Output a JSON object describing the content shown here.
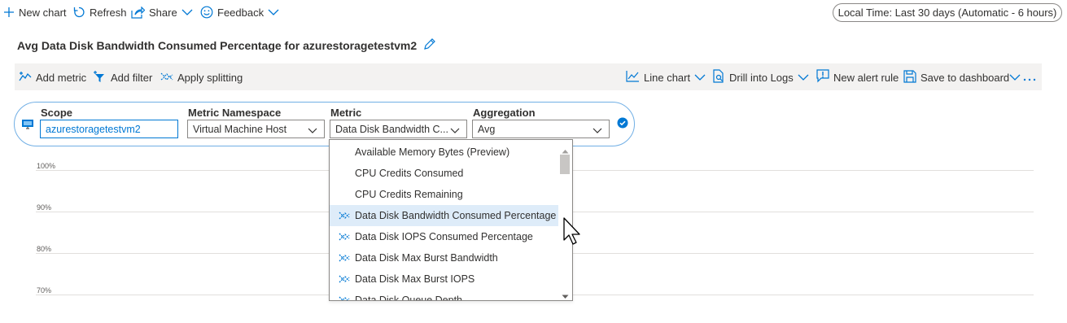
{
  "toolbar": {
    "new_chart": "New chart",
    "refresh": "Refresh",
    "share": "Share",
    "feedback": "Feedback",
    "time_range": "Local Time: Last 30 days (Automatic - 6 hours)"
  },
  "page": {
    "title": "Avg Data Disk Bandwidth Consumed Percentage for azurestoragetestvm2"
  },
  "commands": {
    "add_metric": "Add metric",
    "add_filter": "Add filter",
    "apply_splitting": "Apply splitting",
    "line_chart": "Line chart",
    "drill_into_logs": "Drill into Logs",
    "new_alert_rule": "New alert rule",
    "save_to_dashboard": "Save to dashboard"
  },
  "metric_selector": {
    "scope_label": "Scope",
    "scope_value": "azurestoragetestvm2",
    "namespace_label": "Metric Namespace",
    "namespace_value": "Virtual Machine Host",
    "metric_label": "Metric",
    "metric_value": "Data Disk Bandwidth C...",
    "aggregation_label": "Aggregation",
    "aggregation_value": "Avg"
  },
  "chart": {
    "y_ticks": [
      "100%",
      "90%",
      "80%",
      "70%"
    ]
  },
  "metric_dropdown": {
    "items": [
      {
        "label": "Available Memory Bytes (Preview)",
        "icon": "none"
      },
      {
        "label": "CPU Credits Consumed",
        "icon": "none"
      },
      {
        "label": "CPU Credits Remaining",
        "icon": "none"
      },
      {
        "label": "Data Disk Bandwidth Consumed Percentage",
        "icon": "metric-icon",
        "selected": true
      },
      {
        "label": "Data Disk IOPS Consumed Percentage",
        "icon": "metric-icon"
      },
      {
        "label": "Data Disk Max Burst Bandwidth",
        "icon": "metric-icon"
      },
      {
        "label": "Data Disk Max Burst IOPS",
        "icon": "metric-icon"
      },
      {
        "label": "Data Disk Queue Depth",
        "icon": "metric-icon"
      }
    ]
  },
  "colors": {
    "accent": "#0078d4",
    "selected_bg": "#deecf9",
    "command_bar_bg": "#f3f2f1"
  }
}
